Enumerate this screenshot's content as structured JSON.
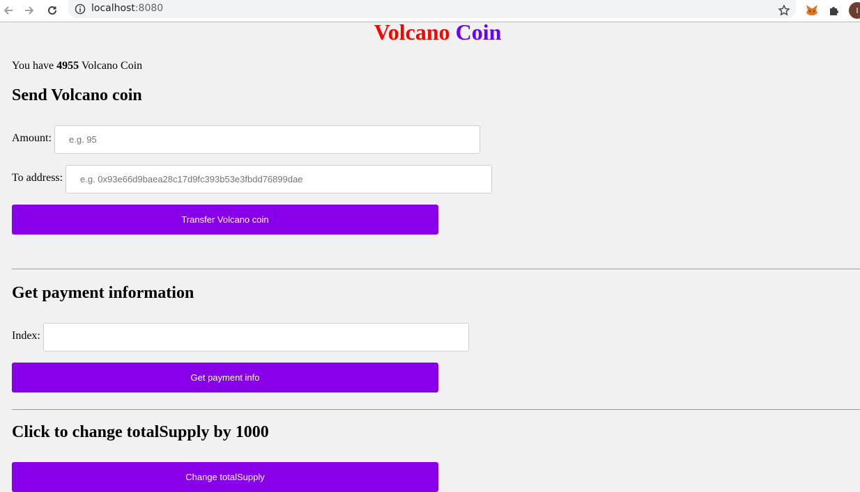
{
  "browser": {
    "url_host": "localhost",
    "url_port": ":8080",
    "profile_initial": "I"
  },
  "page": {
    "title_word1": "Volcano",
    "title_word2": "Coin",
    "balance_prefix": "You have",
    "balance_amount": "4955",
    "balance_suffix": "Volcano Coin"
  },
  "send": {
    "heading": "Send Volcano coin",
    "amount_label": "Amount:",
    "amount_placeholder": "e.g. 95",
    "address_label": "To address:",
    "address_placeholder": "e.g. 0x93e66d9baea28c17d9fc393b53e3fbdd76899dae",
    "button_label": "Transfer Volcano coin"
  },
  "payment": {
    "heading": "Get payment information",
    "index_label": "Index:",
    "index_value": "",
    "button_label": "Get payment info"
  },
  "supply": {
    "heading": "Click to change totalSupply by 1000",
    "button_label": "Change totalSupply"
  },
  "colors": {
    "title_word1": "#ff0000",
    "title_word2": "#6600ff",
    "button": "#8800ea",
    "background": "#f1f1f1"
  },
  "icons": [
    "back-arrow-icon",
    "forward-arrow-icon",
    "reload-icon",
    "info-icon",
    "star-icon",
    "metamask-fox-icon",
    "puzzle-extension-icon"
  ]
}
